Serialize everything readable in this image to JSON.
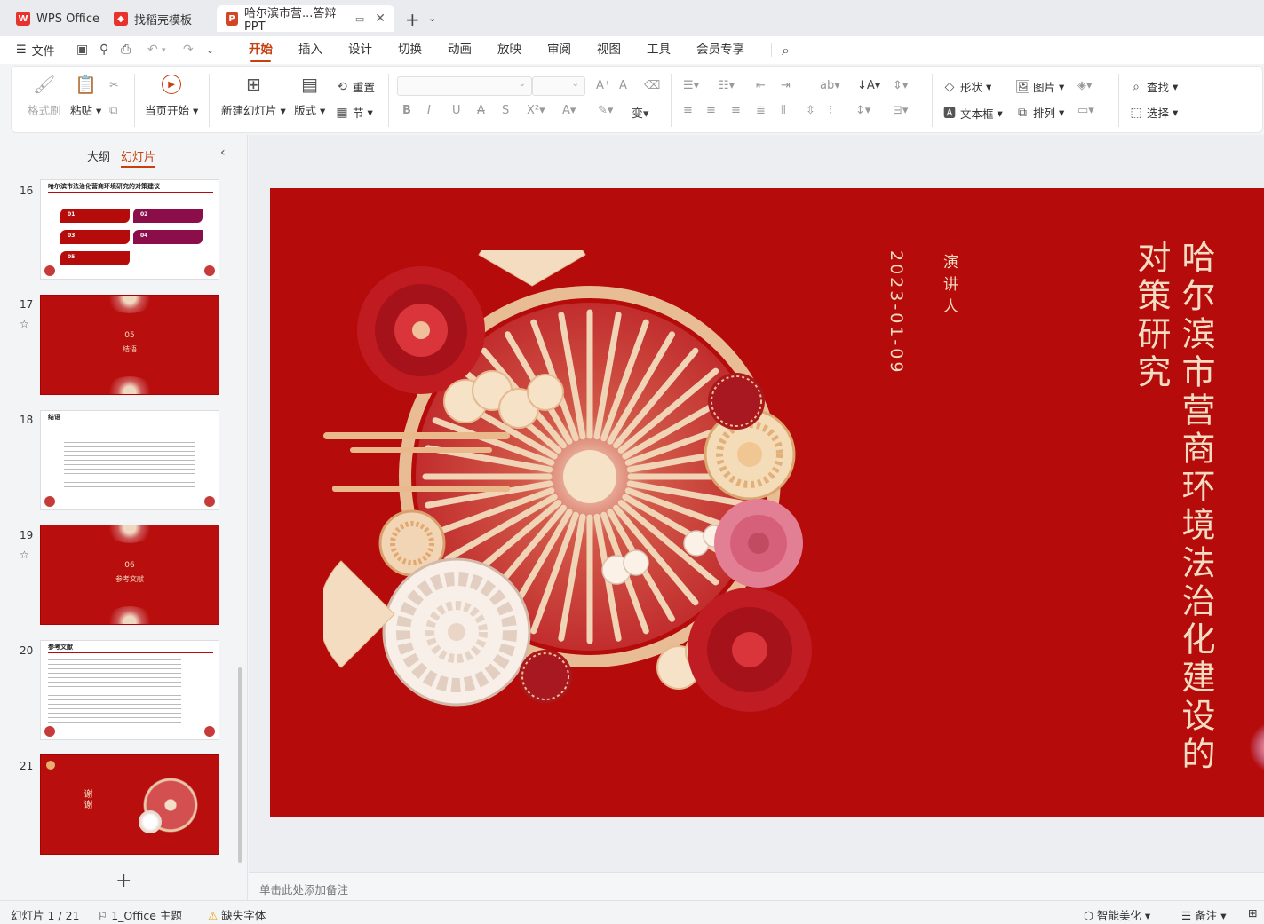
{
  "tabs": [
    {
      "label": "WPS Office",
      "icon": "wps-logo-icon"
    },
    {
      "label": "找稻壳模板",
      "icon": "docer-icon"
    },
    {
      "label": "哈尔滨市营...答辩PPT",
      "icon": "ppt-icon",
      "active": true
    }
  ],
  "menu": {
    "file": "文件",
    "tabs": [
      "开始",
      "插入",
      "设计",
      "切换",
      "动画",
      "放映",
      "审阅",
      "视图",
      "工具",
      "会员专享"
    ],
    "active_tab": "开始"
  },
  "ribbon": {
    "format_painter": "格式刷",
    "paste": "粘贴",
    "start_from_current": "当页开始",
    "new_slide": "新建幻灯片",
    "layout": "版式",
    "reset": "重置",
    "section": "节",
    "shape": "形状",
    "picture": "图片",
    "textbox": "文本框",
    "arrange": "排列",
    "find": "查找",
    "select": "选择"
  },
  "panel": {
    "outline_tab": "大纲",
    "slides_tab": "幻灯片",
    "thumbnails": [
      {
        "num": "16",
        "title": "哈尔滨市法治化营商环境研究的对策建议",
        "items": [
          "01",
          "02",
          "03",
          "04",
          "05"
        ]
      },
      {
        "num": "17",
        "section_num": "05",
        "section_title": "结语"
      },
      {
        "num": "18",
        "title": "结语"
      },
      {
        "num": "19",
        "section_num": "06",
        "section_title": "参考文献"
      },
      {
        "num": "20",
        "title": "参考文献"
      },
      {
        "num": "21",
        "text": "谢谢"
      }
    ]
  },
  "slide": {
    "title_line1": "哈尔滨市营商环境法治化建设的",
    "title_line2": "对策研究",
    "presenter_label": "演讲人",
    "date": "2023-01-09"
  },
  "notes_placeholder": "单击此处添加备注",
  "status": {
    "slide_counter": "幻灯片 1 / 21",
    "theme": "1_Office 主题",
    "missing_font": "缺失字体",
    "smart_beautify": "智能美化",
    "notes": "备注"
  },
  "colors": {
    "accent": "#c7400e",
    "slide_red": "#b50b0b",
    "gold_text": "#f4dcc2"
  }
}
